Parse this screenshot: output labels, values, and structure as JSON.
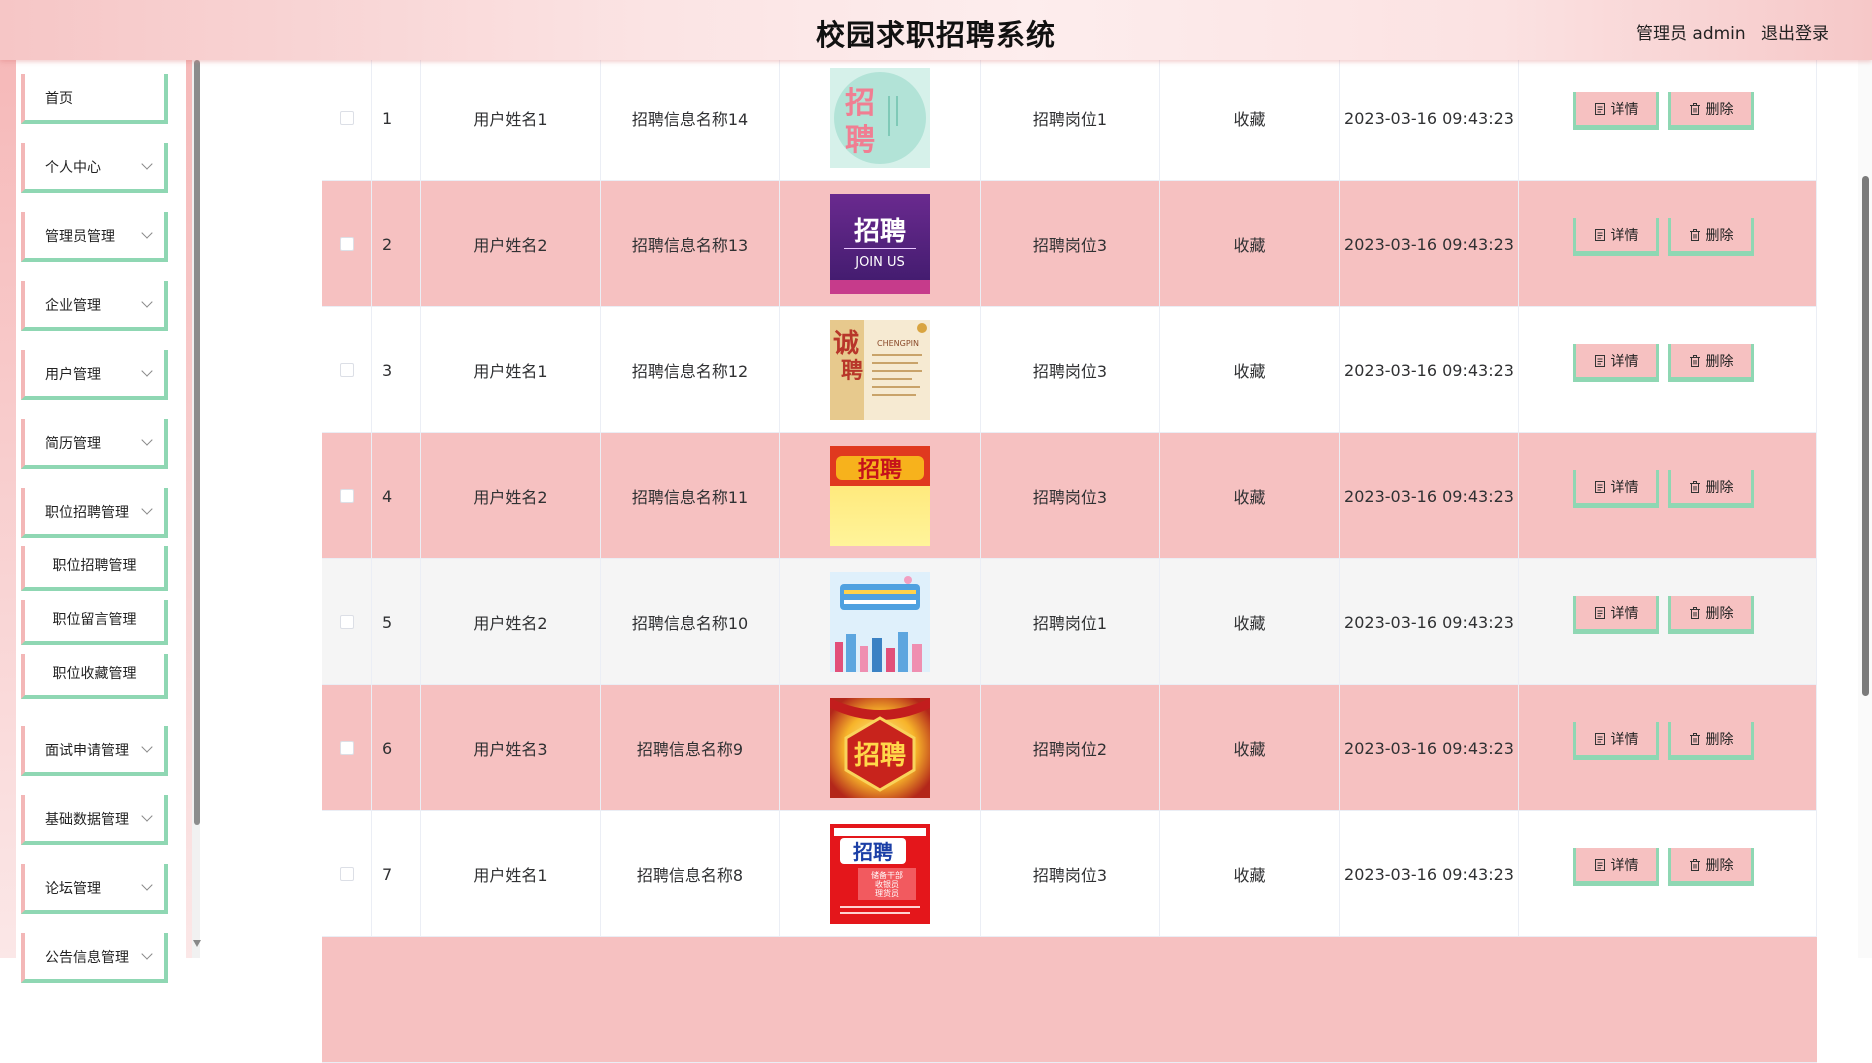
{
  "header": {
    "title": "校园求职招聘系统",
    "user": "管理员 admin",
    "logout": "退出登录"
  },
  "sidebar": {
    "items": [
      {
        "label": "首页",
        "has_arrow": false
      },
      {
        "label": "个人中心",
        "has_arrow": true
      },
      {
        "label": "管理员管理",
        "has_arrow": true
      },
      {
        "label": "企业管理",
        "has_arrow": true
      },
      {
        "label": "用户管理",
        "has_arrow": true
      },
      {
        "label": "简历管理",
        "has_arrow": true
      },
      {
        "label": "职位招聘管理",
        "has_arrow": true,
        "expanded": true
      },
      {
        "label": "面试申请管理",
        "has_arrow": true
      },
      {
        "label": "基础数据管理",
        "has_arrow": true
      },
      {
        "label": "论坛管理",
        "has_arrow": true
      },
      {
        "label": "公告信息管理",
        "has_arrow": true
      }
    ],
    "subitems": [
      "职位招聘管理",
      "职位留言管理",
      "职位收藏管理"
    ]
  },
  "table": {
    "rows": [
      {
        "index": "1",
        "user": "用户姓名1",
        "job_name": "招聘信息名称14",
        "position": "招聘岗位1",
        "type": "收藏",
        "time": "2023-03-16 09:43:23",
        "poster": "poster-teal-pink"
      },
      {
        "index": "2",
        "user": "用户姓名2",
        "job_name": "招聘信息名称13",
        "position": "招聘岗位3",
        "type": "收藏",
        "time": "2023-03-16 09:43:23",
        "poster": "poster-purple-joinus"
      },
      {
        "index": "3",
        "user": "用户姓名1",
        "job_name": "招聘信息名称12",
        "position": "招聘岗位3",
        "type": "收藏",
        "time": "2023-03-16 09:43:23",
        "poster": "poster-beige-chengpin"
      },
      {
        "index": "4",
        "user": "用户姓名2",
        "job_name": "招聘信息名称11",
        "position": "招聘岗位3",
        "type": "收藏",
        "time": "2023-03-16 09:43:23",
        "poster": "poster-red-yellow"
      },
      {
        "index": "5",
        "user": "用户姓名2",
        "job_name": "招聘信息名称10",
        "position": "招聘岗位1",
        "type": "收藏",
        "time": "2023-03-16 09:43:23",
        "poster": "poster-sky-city"
      },
      {
        "index": "6",
        "user": "用户姓名3",
        "job_name": "招聘信息名称9",
        "position": "招聘岗位2",
        "type": "收藏",
        "time": "2023-03-16 09:43:23",
        "poster": "poster-gold-red"
      },
      {
        "index": "7",
        "user": "用户姓名1",
        "job_name": "招聘信息名称8",
        "position": "招聘岗位3",
        "type": "收藏",
        "time": "2023-03-16 09:43:23",
        "poster": "poster-red-sticker"
      }
    ],
    "actions": {
      "detail": "详情",
      "delete": "删除"
    },
    "poster_texts": {
      "zhao": "招",
      "pin": "聘",
      "zhaopin": "招聘",
      "joinus": "JOIN US",
      "cheng": "诚",
      "chengpin_en": "CHENGPIN",
      "sticker_lines": [
        "储备干部",
        "收银员",
        "理货员"
      ]
    }
  },
  "colors": {
    "row_pink": "#f6c1c1",
    "row_grey": "#f5f5f5",
    "accent_green": "#8fd7b3",
    "accent_pink": "#f3b7b7"
  }
}
